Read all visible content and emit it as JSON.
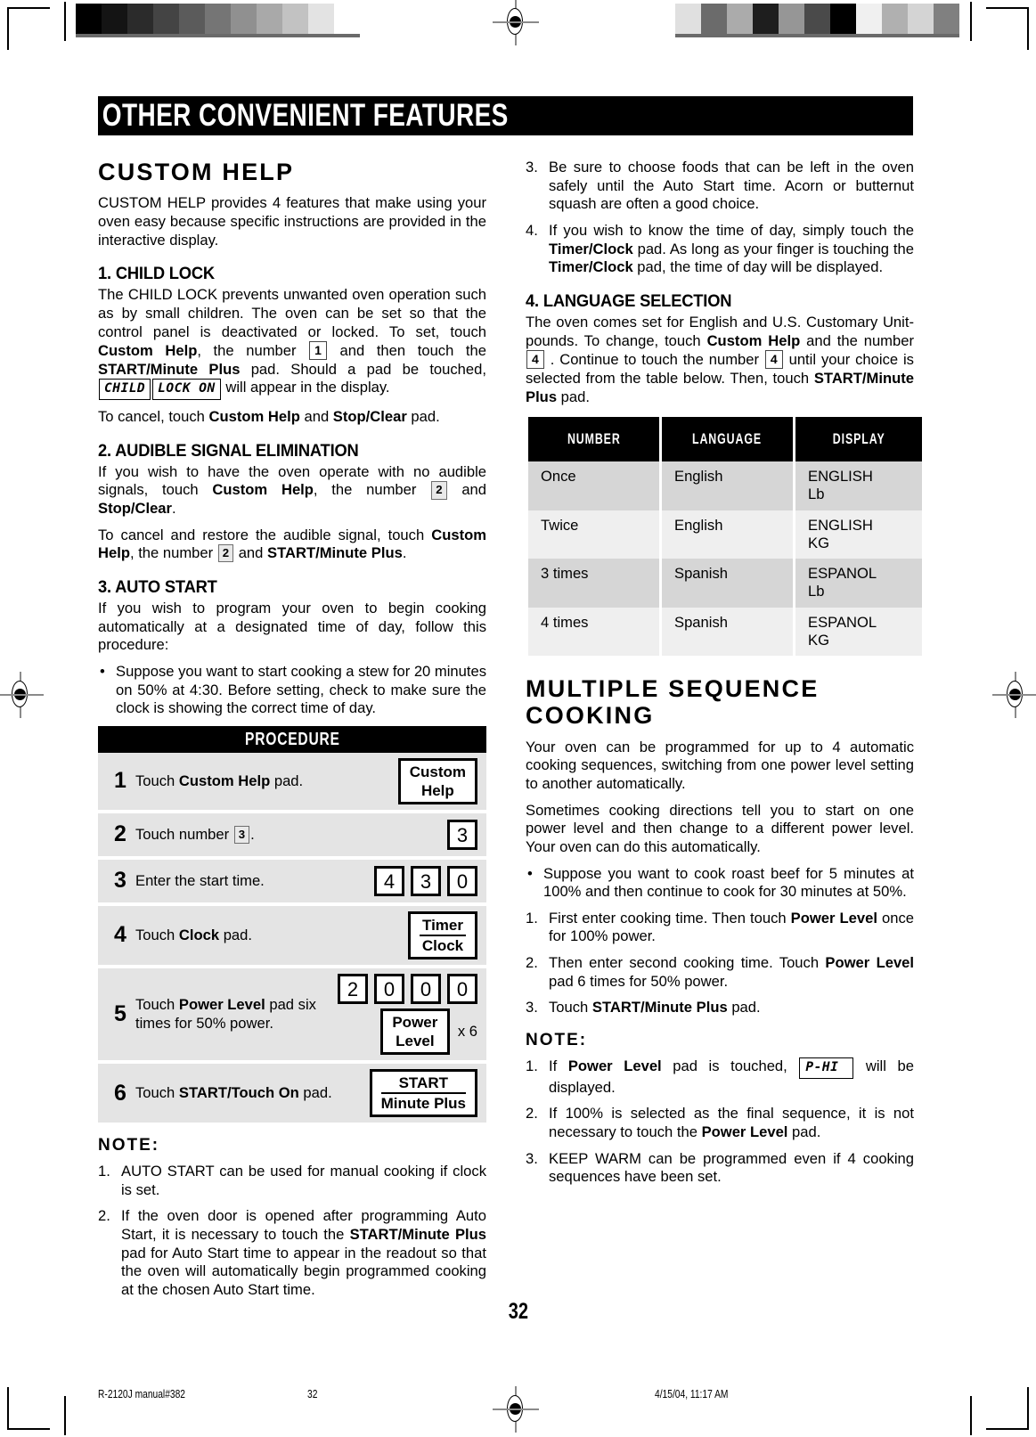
{
  "header": {
    "title": "OTHER CONVENIENT FEATURES"
  },
  "left": {
    "section_title": "CUSTOM HELP",
    "intro": "CUSTOM HELP provides 4 features that make using your oven easy because specific instructions are provided in the interactive display.",
    "child_lock": {
      "heading": "1. CHILD LOCK",
      "body_1": "The CHILD LOCK prevents unwanted oven operation such as by small children. The oven can be set so that the control panel is deactivated or locked. To set, touch ",
      "b_custom_help": "Custom Help",
      "body_2": ", the number ",
      "key_1": "1",
      "body_3": " and then touch the ",
      "b_start": "START/Minute Plus",
      "body_4": " pad. Should a pad be touched, ",
      "lcd_child": "CHILD",
      "lcd_lock_on": "LOCK ON",
      "body_5": " will appear in the display.",
      "cancel_1": "To cancel, touch ",
      "cancel_b1": "Custom Help",
      "cancel_2": " and ",
      "cancel_b2": "Stop/Clear",
      "cancel_3": " pad."
    },
    "audible": {
      "heading": "2. AUDIBLE SIGNAL ELIMINATION",
      "body_1": "If you wish to have the oven operate with no audible signals, touch ",
      "b_custom_help": "Custom Help",
      "body_2": ", the number ",
      "key_2": "2",
      "body_3": " and ",
      "b_stop": "Stop/Clear",
      "body_4": ".",
      "restore_1": "To cancel and restore the audible signal, touch ",
      "restore_b1": "Custom Help",
      "restore_2": ", the number ",
      "restore_key": "2",
      "restore_3": " and ",
      "restore_b2": "START/Minute Plus",
      "restore_4": "."
    },
    "auto_start": {
      "heading": "3. AUTO START",
      "body": "If you wish to program your oven to begin cooking automatically at a designated time of day, follow this procedure:",
      "bullet": "Suppose you want to start cooking a stew for 20 minutes on 50% at 4:30. Before setting, check to make sure the clock is showing the correct time of day."
    },
    "procedure": {
      "title": "PROCEDURE",
      "rows": [
        {
          "num": "1",
          "text_a": "Touch ",
          "text_b": "Custom Help",
          "text_c": " pad.",
          "pad_line1": "Custom",
          "pad_line2": "Help",
          "pad_style": "two-line-nosep"
        },
        {
          "num": "2",
          "text_a": "Touch number ",
          "inline_key": "3",
          "text_c": ".",
          "keys": [
            "3"
          ]
        },
        {
          "num": "3",
          "text_a": "Enter the start time.",
          "keys": [
            "4",
            "3",
            "0"
          ]
        },
        {
          "num": "4",
          "text_a": "Touch ",
          "text_b": "Clock",
          "text_c": " pad.",
          "pad_line1": "Timer",
          "pad_line2": "Clock",
          "pad_style": "two-line-sep"
        },
        {
          "num": "5",
          "text_a": "Touch ",
          "text_b": "Power Level",
          "text_c": " pad six times for 50% power.",
          "keys": [
            "2",
            "0",
            "0",
            "0"
          ],
          "pad_line1": "Power",
          "pad_line2": "Level",
          "pad_style": "two-line-nosep",
          "multiplier": "x 6"
        },
        {
          "num": "6",
          "text_a": "Touch ",
          "text_b": "START/Touch On",
          "text_c": " pad.",
          "pad_line1": "START",
          "pad_line2": "Minute Plus",
          "pad_style": "two-line-sep"
        }
      ]
    },
    "note_label": "NOTE:",
    "notes": [
      {
        "mk": "1.",
        "text": "AUTO START can be used for manual cooking if clock is set."
      },
      {
        "mk": "2.",
        "a": "If the oven door is opened after programming Auto Start, it is necessary to touch the ",
        "b": "START/Minute Plus",
        "c": " pad for Auto Start time to appear in the readout so that the oven will automatically begin programmed cooking at the chosen Auto Start time."
      }
    ]
  },
  "right": {
    "notes_cont": [
      {
        "mk": "3.",
        "text": "Be sure to choose foods that can be left in the oven safely until the Auto Start time. Acorn or butternut squash are often a good choice."
      },
      {
        "mk": "4.",
        "a": "If you wish to know the time of day, simply touch the ",
        "b1": "Timer/Clock",
        "c": " pad. As long as your finger is touching the ",
        "b2": "Timer/Clock",
        "d": " pad, the time of day will be displayed."
      }
    ],
    "language": {
      "heading": "4. LANGUAGE SELECTION",
      "body_1": "The oven comes set for English and U.S. Customary Unit-pounds. To change, touch ",
      "b_custom_help": "Custom Help",
      "body_2": " and the number ",
      "key_4a": "4",
      "body_3": " . Continue to touch the number ",
      "key_4b": "4",
      "body_4": " until your choice is selected from the table below. Then, touch ",
      "b_start": "START/Minute Plus",
      "body_5": " pad."
    },
    "table": {
      "columns": [
        "NUMBER",
        "LANGUAGE",
        "DISPLAY"
      ],
      "rows": [
        {
          "number": "Once",
          "language": "English",
          "display": "ENGLISH Lb"
        },
        {
          "number": "Twice",
          "language": "English",
          "display": "ENGLISH KG"
        },
        {
          "number": "3 times",
          "language": "Spanish",
          "display": "ESPANOL Lb"
        },
        {
          "number": "4 times",
          "language": "Spanish",
          "display": "ESPANOL KG"
        }
      ]
    },
    "multiseq": {
      "heading": "MULTIPLE SEQUENCE COOKING",
      "p1": "Your oven can be programmed for up to 4 automatic cooking sequences, switching from one power level setting to another automatically.",
      "p2": "Sometimes cooking directions tell you to start on one power level and then change to a different power level. Your oven can do this automatically.",
      "bullet": "Suppose you want to cook roast beef for 5 minutes at 100% and then continue to cook for 30 minutes at 50%.",
      "steps": [
        {
          "mk": "1.",
          "a": "First enter cooking time. Then touch ",
          "b": "Power Level",
          "c": " once for 100% power."
        },
        {
          "mk": "2.",
          "a": "Then enter second cooking time. Touch ",
          "b": "Power Level",
          "c": " pad 6 times for 50% power."
        },
        {
          "mk": "3.",
          "a": "Touch ",
          "b": "START/Minute Plus",
          "c": " pad."
        }
      ],
      "note_label": "NOTE:",
      "notes": [
        {
          "mk": "1.",
          "a": "If ",
          "b": "Power Level",
          "c": " pad is touched, ",
          "lcd": "P-HI",
          "d": " will be displayed."
        },
        {
          "mk": "2.",
          "a": "If 100% is selected as the final sequence, it is not necessary to touch the ",
          "b": "Power Level",
          "c": " pad."
        },
        {
          "mk": "3.",
          "text": "KEEP WARM can be programmed even if 4 cooking sequences have been set."
        }
      ]
    }
  },
  "page_number": "32",
  "footer": {
    "file": "R-2120J manual#382",
    "page": "32",
    "timestamp": "4/15/04, 11:17 AM"
  },
  "calibration": {
    "left_bar": [
      "#000000",
      "#141414",
      "#2b2b2b",
      "#444444",
      "#5b5b5b",
      "#757575",
      "#909090",
      "#a9a9a9",
      "#c2c2c2",
      "#e3e3e3",
      "#ffffff"
    ],
    "right_bar": [
      "#e0e0e0",
      "#6b6b6b",
      "#ababab",
      "#1e1e1e",
      "#969696",
      "#4a4a4a",
      "#000000",
      "#f0f0f0",
      "#b0b0b0",
      "#d4d4d4",
      "#808080"
    ]
  }
}
